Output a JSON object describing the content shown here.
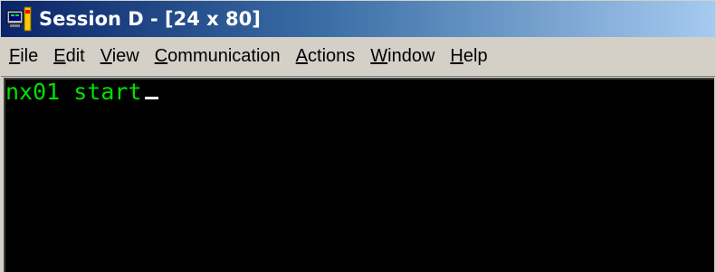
{
  "window": {
    "title": "Session D - [24 x 80]",
    "icon": "terminal-session-icon"
  },
  "menubar": {
    "items": [
      {
        "label_pre": "",
        "mnemonic": "F",
        "label_post": "ile"
      },
      {
        "label_pre": "",
        "mnemonic": "E",
        "label_post": "dit"
      },
      {
        "label_pre": "",
        "mnemonic": "V",
        "label_post": "iew"
      },
      {
        "label_pre": "",
        "mnemonic": "C",
        "label_post": "ommunication"
      },
      {
        "label_pre": "",
        "mnemonic": "A",
        "label_post": "ctions"
      },
      {
        "label_pre": "",
        "mnemonic": "W",
        "label_post": "indow"
      },
      {
        "label_pre": "",
        "mnemonic": "H",
        "label_post": "elp"
      }
    ]
  },
  "terminal": {
    "line1": "nx01 start",
    "text_color": "#00e000",
    "background": "#000000"
  }
}
